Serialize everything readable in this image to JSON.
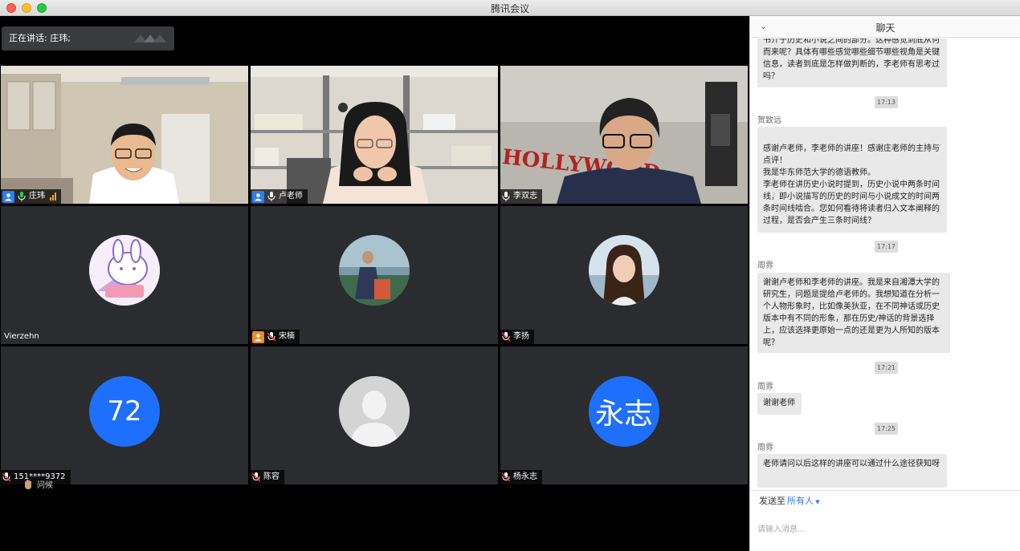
{
  "window": {
    "title": "腾讯会议"
  },
  "speaking": {
    "label": "正在讲话: 庄玮;"
  },
  "tiles": [
    {
      "name": "庄玮"
    },
    {
      "name": "卢老师"
    },
    {
      "name": "李双志"
    },
    {
      "name": "Vierzehn"
    },
    {
      "name": "宋楠"
    },
    {
      "name": "李扬"
    },
    {
      "name": "151****9372",
      "avatar_text": "72"
    },
    {
      "name": "陈容"
    },
    {
      "name": "杨永志",
      "avatar_text": "永志"
    }
  ],
  "raise_hand": {
    "label": "问候"
  },
  "colors": {
    "active_speaker": "#34c759",
    "avatar_blue": "#1f6fff",
    "link_blue": "#2f7cf6"
  },
  "chat": {
    "title": "聊天",
    "messages": [
      {
        "text": "书介于历史和小说之间的部分。这种感觉到底从何而来呢？具体有哪些感觉哪些细节哪些视角是关键信息，读者到底是怎样做判断的，李老师有思考过吗？"
      },
      {
        "time": "17:13"
      },
      {
        "sender": "贺致远",
        "text": "感谢卢老师，李老师的讲座！感谢庄老师的主持与点评！\n我是华东师范大学的德语教师。\n李老师在讲历史小说时提到，历史小说中两条时间线，即小说描写的历史的时间与小说成文的时间两条时间线啮合。您如何看待将读者归入文本阐释的过程，是否会产生三条时间线？"
      },
      {
        "time": "17:17"
      },
      {
        "sender": "周雰",
        "text": "谢谢卢老师和李老师的讲座。我是来自湘潭大学的研究生，问题是提给卢老师的。我想知道在分析一个人物形象时，比如像美狄亚，在不同神话或历史版本中有不同的形象，那在历史/神话的背景选择上，应该选择更原始一点的还是更为人所知的版本呢？"
      },
      {
        "time": "17:21"
      },
      {
        "sender": "周雰",
        "text": "谢谢老师"
      },
      {
        "time": "17:25"
      },
      {
        "sender": "周雰",
        "text": "老师请问以后这样的讲座可以通过什么途径获知呀"
      }
    ],
    "send_to_label": "发送至",
    "send_target": "所有人",
    "input_placeholder": "请输入消息..."
  }
}
